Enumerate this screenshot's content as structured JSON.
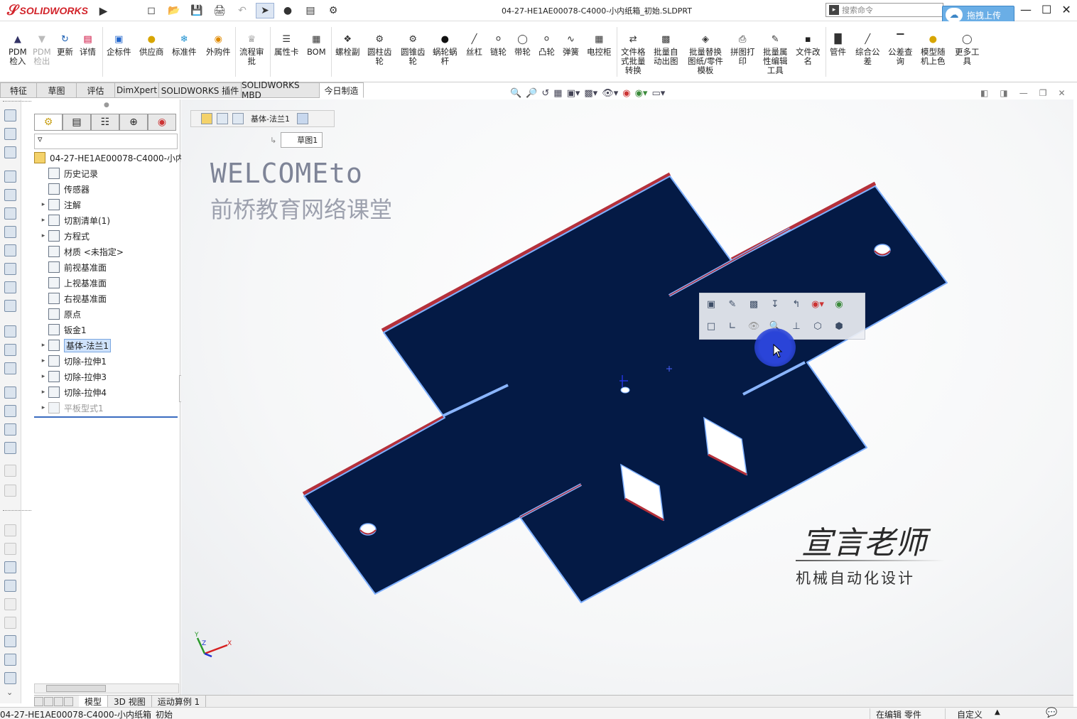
{
  "app": {
    "brand": "SOLIDWORKS",
    "doc_title": "04-27-HE1AE00078-C4000-小内纸箱_初始.SLDPRT",
    "search_placeholder": "搜索命令",
    "upload_label": "拖拽上传"
  },
  "ribbon": [
    {
      "label": "PDM\n检入",
      "icon": "checkin-icon",
      "disabled": false
    },
    {
      "label": "PDM\n检出",
      "icon": "checkout-icon",
      "disabled": true
    },
    {
      "label": "更新",
      "icon": "update-icon",
      "disabled": false
    },
    {
      "label": "详情",
      "icon": "details-icon",
      "disabled": false
    },
    {
      "label": "企标件",
      "icon": "enterprise-part-icon",
      "disabled": false
    },
    {
      "label": "供应商",
      "icon": "supplier-icon",
      "disabled": false
    },
    {
      "label": "标准件",
      "icon": "standard-part-icon",
      "disabled": false
    },
    {
      "label": "外购件",
      "icon": "purchased-part-icon",
      "disabled": false
    },
    {
      "label": "流程审\n批",
      "icon": "workflow-icon",
      "disabled": false
    },
    {
      "label": "属性卡",
      "icon": "property-card-icon",
      "disabled": false
    },
    {
      "label": "BOM",
      "icon": "bom-icon",
      "disabled": false
    },
    {
      "label": "螺栓副",
      "icon": "bolt-icon",
      "disabled": false
    },
    {
      "label": "圆柱齿\n轮",
      "icon": "spur-gear-icon",
      "disabled": false
    },
    {
      "label": "圆锥齿\n轮",
      "icon": "bevel-gear-icon",
      "disabled": false
    },
    {
      "label": "蜗轮蜗\n杆",
      "icon": "worm-gear-icon",
      "disabled": false
    },
    {
      "label": "丝杠",
      "icon": "lead-screw-icon",
      "disabled": false
    },
    {
      "label": "链轮",
      "icon": "sprocket-icon",
      "disabled": false
    },
    {
      "label": "带轮",
      "icon": "pulley-icon",
      "disabled": false
    },
    {
      "label": "凸轮",
      "icon": "cam-icon",
      "disabled": false
    },
    {
      "label": "弹簧",
      "icon": "spring-icon",
      "disabled": false
    },
    {
      "label": "电控柜",
      "icon": "cabinet-icon",
      "disabled": false
    },
    {
      "label": "文件格\n式批量\n转换",
      "icon": "batch-convert-icon",
      "disabled": false
    },
    {
      "label": "批量自\n动出图",
      "icon": "batch-drawing-icon",
      "disabled": false
    },
    {
      "label": "批量替换\n图纸/零件\n模板",
      "icon": "template-replace-icon",
      "disabled": false
    },
    {
      "label": "拼图打\n印",
      "icon": "print-icon",
      "disabled": false
    },
    {
      "label": "批量属\n性编辑\n工具",
      "icon": "batch-property-icon",
      "disabled": false
    },
    {
      "label": "文件改\n名",
      "icon": "rename-icon",
      "disabled": false
    },
    {
      "label": "管件",
      "icon": "pipe-icon",
      "disabled": false
    },
    {
      "label": "综合公\n差",
      "icon": "tolerance-icon",
      "disabled": false
    },
    {
      "label": "公差查\n询",
      "icon": "tolerance-query-icon",
      "disabled": false
    },
    {
      "label": "模型随\n机上色",
      "icon": "random-color-icon",
      "disabled": false
    },
    {
      "label": "更多工\n具",
      "icon": "more-tools-icon",
      "disabled": false
    }
  ],
  "cmd_tabs": [
    "特征",
    "草图",
    "评估",
    "DimXpert",
    "SOLIDWORKS 插件",
    "SOLIDWORKS MBD",
    "今日制造"
  ],
  "cmd_tabs_active": 6,
  "tree": {
    "root": "04-27-HE1AE00078-C4000-小内",
    "items": [
      {
        "label": "历史记录",
        "expand": false
      },
      {
        "label": "传感器",
        "expand": false
      },
      {
        "label": "注解",
        "expand": true
      },
      {
        "label": "切割清单(1)",
        "expand": true
      },
      {
        "label": "方程式",
        "expand": true
      },
      {
        "label": "材质 <未指定>",
        "expand": false
      },
      {
        "label": "前视基准面",
        "expand": false
      },
      {
        "label": "上视基准面",
        "expand": false
      },
      {
        "label": "右视基准面",
        "expand": false
      },
      {
        "label": "原点",
        "expand": false
      },
      {
        "label": "钣金1",
        "expand": false
      },
      {
        "label": "基体-法兰1",
        "expand": true,
        "selected": true
      },
      {
        "label": "切除-拉伸1",
        "expand": true
      },
      {
        "label": "切除-拉伸3",
        "expand": true
      },
      {
        "label": "切除-拉伸4",
        "expand": true
      },
      {
        "label": "平板型式1",
        "expand": true,
        "grey": true
      }
    ]
  },
  "breadcrumb": {
    "feature": "基体-法兰1",
    "sketch": "草图1"
  },
  "overlay": {
    "welcome": "WELCOMEto",
    "welcome_cn": "前桥教育网络课堂",
    "watermark": "宣言老师",
    "watermark_sub": "机械自动化设计"
  },
  "triad": {
    "x": "X",
    "y": "Y",
    "z": "Z"
  },
  "bottom_tabs": [
    "模型",
    "3D 视图",
    "运动算例 1"
  ],
  "status": {
    "file": "04-27-HE1AE00078-C4000-小内纸箱_初始",
    "edit": "在编辑 零件",
    "custom": "自定义"
  },
  "colors": {
    "part_fill": "#041a45",
    "part_edge": "#7fb0ff",
    "flange_edge": "#b4303a",
    "accent": "#d2232a"
  }
}
